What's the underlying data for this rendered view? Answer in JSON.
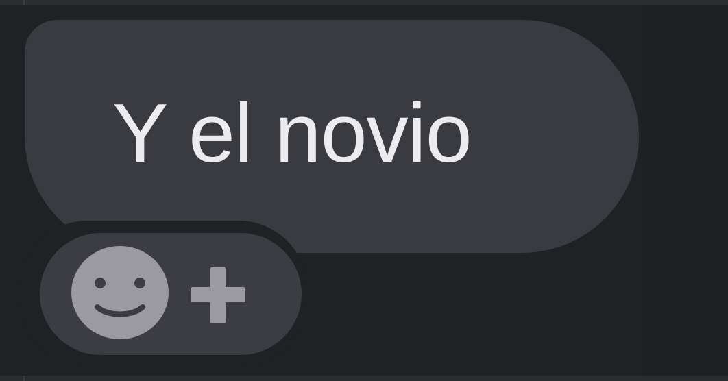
{
  "theme": {
    "background": "#202125",
    "bubble": "#3a3b40",
    "text": "#ececee",
    "icon": "#9a9aa0"
  },
  "message": {
    "text": "Y el novio"
  },
  "reactions": {
    "add_reaction_icon": "smiley-face-icon",
    "plus_icon": "plus-icon"
  }
}
